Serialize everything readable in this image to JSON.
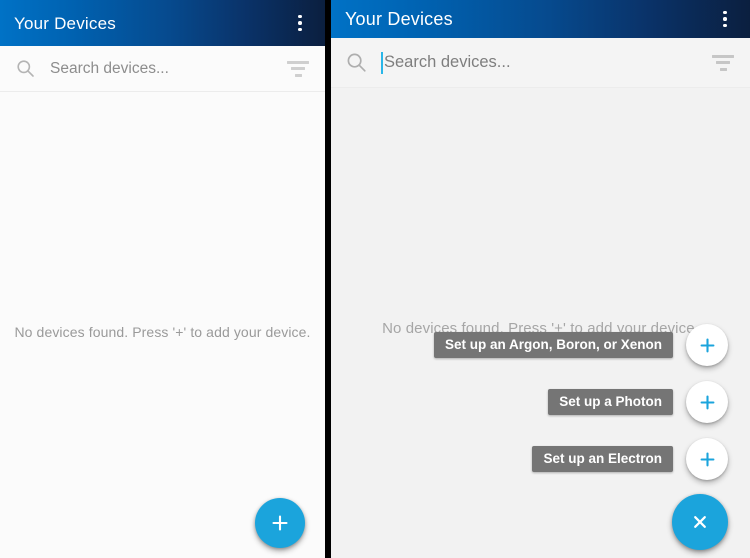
{
  "theme": {
    "appbar_gradient_start": "#0072c6",
    "appbar_gradient_end": "#0b1f3f",
    "accent_cyan": "#1ba4dc",
    "caret_color": "#29b6e8",
    "label_chip_bg": "#757575",
    "empty_text_color": "#9a9a9a",
    "panel_bg_left": "#fbfbfb",
    "panel_bg_right": "#f2f2f2",
    "divider_color": "#000000"
  },
  "left_panel": {
    "appbar": {
      "title": "Your Devices",
      "overflow_icon": "more-vert-icon"
    },
    "search": {
      "icon": "search-icon",
      "placeholder": "Search devices...",
      "value": "",
      "filter_icon": "filter-list-icon"
    },
    "empty_state": {
      "message": "No devices found. Press '+' to add your device."
    },
    "fab": {
      "icon": "plus-icon",
      "label": "Add device"
    }
  },
  "right_panel": {
    "appbar": {
      "title": "Your Devices",
      "overflow_icon": "more-vert-icon"
    },
    "search": {
      "icon": "search-icon",
      "placeholder": "Search devices...",
      "value": "",
      "caret_visible": true,
      "filter_icon": "filter-list-icon"
    },
    "empty_state": {
      "message": "No devices found. Press '+' to add your device."
    },
    "speed_dial": {
      "expanded": true,
      "items": [
        {
          "label": "Set up an Argon, Boron, or Xenon",
          "icon": "plus-icon"
        },
        {
          "label": "Set up a Photon",
          "icon": "plus-icon"
        },
        {
          "label": "Set up an Electron",
          "icon": "plus-icon"
        }
      ]
    },
    "fab": {
      "icon": "close-icon",
      "label": "Close menu"
    }
  }
}
